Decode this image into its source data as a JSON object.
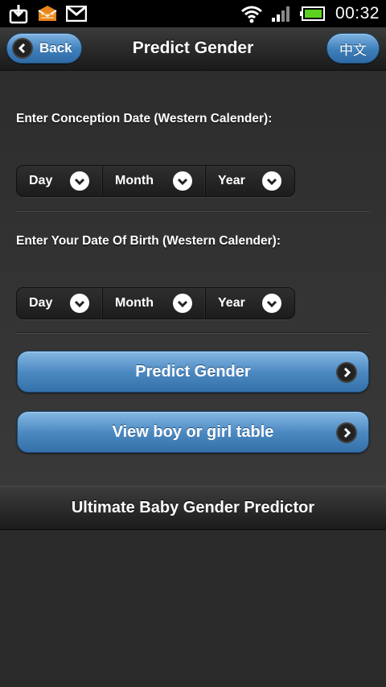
{
  "status_bar": {
    "time": "00:32",
    "icons": [
      "download-icon",
      "mail-icon",
      "gmail-icon",
      "wifi-icon",
      "signal-icon",
      "battery-icon"
    ]
  },
  "header": {
    "back_label": "Back",
    "title": "Predict Gender",
    "language_label": "中文"
  },
  "conception": {
    "label": "Enter Conception Date (Western Calender):",
    "day": "Day",
    "month": "Month",
    "year": "Year"
  },
  "birth": {
    "label": "Enter Your Date Of Birth (Western Calender):",
    "day": "Day",
    "month": "Month",
    "year": "Year"
  },
  "actions": {
    "predict_label": "Predict Gender",
    "table_label": "View boy or girl table"
  },
  "footer": {
    "title": "Ultimate Baby Gender Predictor"
  },
  "colors": {
    "accent_blue": "#4e8ac2",
    "battery_green": "#5bd21f",
    "background": "#2c2c2c"
  }
}
